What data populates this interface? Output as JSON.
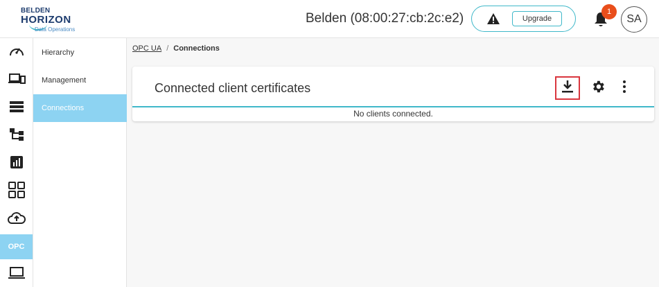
{
  "header": {
    "logo": {
      "line1": "BELDEN",
      "line2": "HORIZON",
      "tagline": "Data Operations"
    },
    "device_title": "Belden (08:00:27:cb:2c:e2)",
    "upgrade_label": "Upgrade",
    "notification_count": "1",
    "user_initials": "SA"
  },
  "rail": {
    "items": [
      {
        "icon": "dashboard-gauge-icon"
      },
      {
        "icon": "devices-icon"
      },
      {
        "icon": "list-icon"
      },
      {
        "icon": "hierarchy-icon"
      },
      {
        "icon": "analytics-icon"
      },
      {
        "icon": "apps-grid-icon"
      },
      {
        "icon": "cloud-upload-icon"
      },
      {
        "icon": "opc",
        "label": "OPC",
        "active": true
      },
      {
        "icon": "laptop-icon"
      }
    ]
  },
  "subnav": {
    "items": [
      {
        "label": "Hierarchy"
      },
      {
        "label": "Management"
      },
      {
        "label": "Connections",
        "active": true
      }
    ]
  },
  "breadcrumb": {
    "parent": "OPC UA",
    "separator": "/",
    "current": "Connections"
  },
  "card": {
    "title": "Connected client certificates",
    "empty_message": "No clients connected."
  },
  "colors": {
    "accent": "#3fb8c9",
    "active_nav": "#8dd3f2",
    "badge": "#e94e1b",
    "highlight_border": "#d9363e"
  }
}
